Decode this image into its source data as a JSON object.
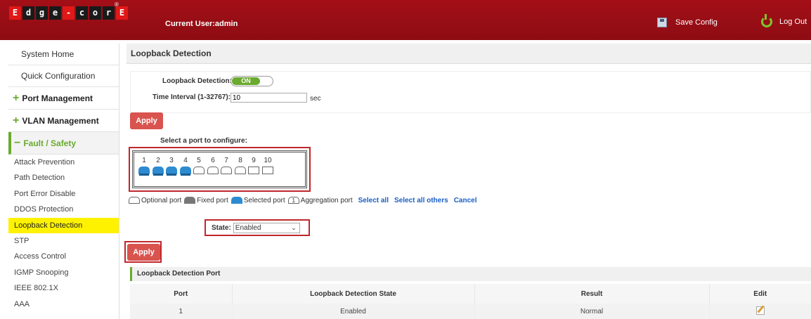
{
  "header": {
    "logo_letters": [
      "E",
      "d",
      "g",
      "e",
      "-",
      "c",
      "o",
      "r",
      "E"
    ],
    "logo_reg": "®",
    "current_user": "Current User:admin",
    "save_config": "Save Config",
    "logout": "Log Out"
  },
  "sidebar": {
    "items": [
      "System Home",
      "Quick Configuration"
    ],
    "groups": [
      {
        "symbol": "+",
        "label": "Port Management"
      },
      {
        "symbol": "+",
        "label": "VLAN Management"
      },
      {
        "symbol": "−",
        "label": "Fault / Safety"
      }
    ],
    "sub_items": [
      "Attack Prevention",
      "Path Detection",
      "Port Error Disable",
      "DDOS Protection",
      "Loopback Detection",
      "STP",
      "Access Control",
      "IGMP Snooping",
      "IEEE 802.1X",
      "AAA"
    ],
    "active_sub_item": "Loopback Detection"
  },
  "main": {
    "title": "Loopback Detection",
    "loopback_label": "Loopback Detection:",
    "toggle_state": "ON",
    "interval_label": "Time Interval (1-32767):",
    "interval_value": "10",
    "interval_unit": "sec",
    "apply_label": "Apply",
    "select_port_label": "Select a port to configure:",
    "ports": [
      {
        "num": "1",
        "type": "selected"
      },
      {
        "num": "2",
        "type": "selected"
      },
      {
        "num": "3",
        "type": "selected"
      },
      {
        "num": "4",
        "type": "selected"
      },
      {
        "num": "5",
        "type": "optional"
      },
      {
        "num": "6",
        "type": "optional"
      },
      {
        "num": "7",
        "type": "optional"
      },
      {
        "num": "8",
        "type": "optional"
      },
      {
        "num": "9",
        "type": "square"
      },
      {
        "num": "10",
        "type": "square"
      }
    ],
    "legend": {
      "optional": "Optional port",
      "fixed": "Fixed port",
      "selected": "Selected port",
      "agg_icon": "1",
      "aggregation": "Aggregation port",
      "select_all": "Select all",
      "select_all_others": "Select all others",
      "cancel": "Cancel"
    },
    "state_label": "State:",
    "state_value": "Enabled",
    "apply2_label": "Apply",
    "table": {
      "title": "Loopback Detection Port",
      "columns": [
        "Port",
        "Loopback Detection State",
        "Result",
        "Edit"
      ],
      "rows": [
        [
          "1",
          "Enabled",
          "Normal"
        ]
      ]
    }
  },
  "colors": {
    "header_red": "#a30f17",
    "accent_green": "#6aaa2e",
    "apply_red": "#d9534f",
    "active_yellow": "#fff200",
    "port_blue": "#2d8bd1",
    "link_blue": "#1a5ec4"
  }
}
